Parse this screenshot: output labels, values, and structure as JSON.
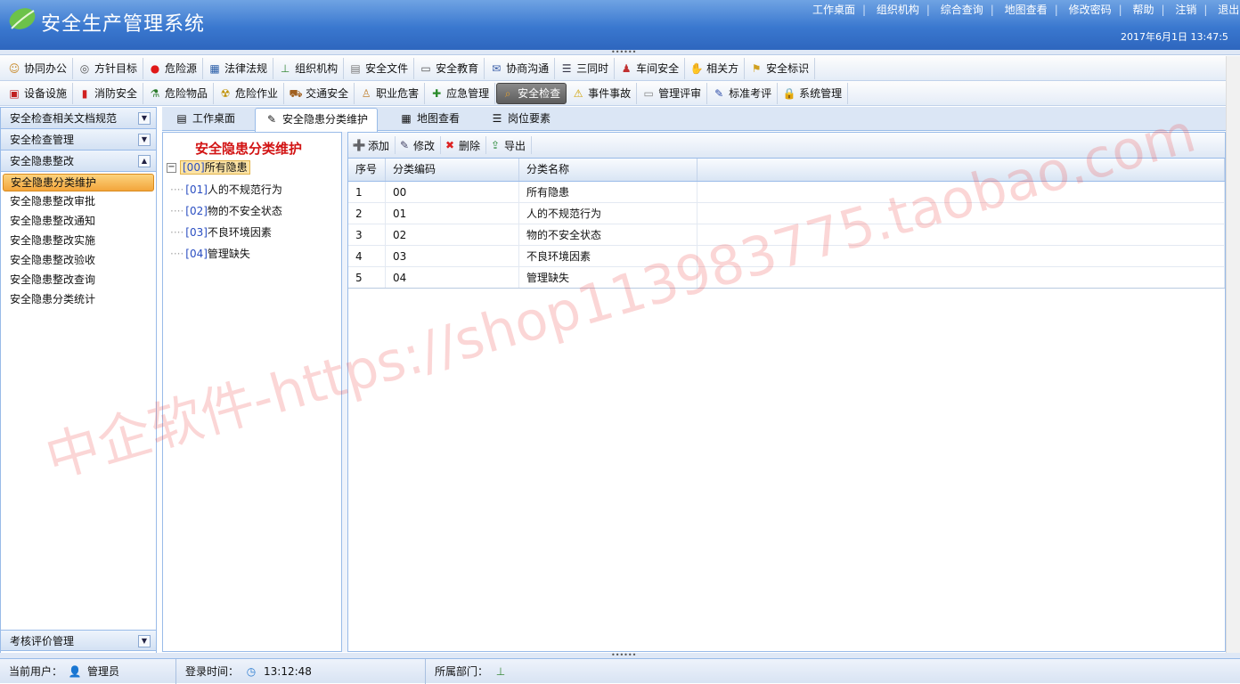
{
  "header": {
    "title": "安全生产管理系统",
    "links": [
      "工作桌面",
      "组织机构",
      "综合查询",
      "地图查看",
      "修改密码",
      "帮助",
      "注销",
      "退出"
    ],
    "datetime": "2017年6月1日 13:47:5"
  },
  "toolbar_row1": [
    {
      "label": "协同办公",
      "icon": "people-icon"
    },
    {
      "label": "方针目标",
      "icon": "target-icon"
    },
    {
      "label": "危险源",
      "icon": "red-dot-icon"
    },
    {
      "label": "法律法规",
      "icon": "table-icon"
    },
    {
      "label": "组织机构",
      "icon": "org-icon"
    },
    {
      "label": "安全文件",
      "icon": "notepad-icon"
    },
    {
      "label": "安全教育",
      "icon": "speech-icon"
    },
    {
      "label": "协商沟通",
      "icon": "mail-icon"
    },
    {
      "label": "三同时",
      "icon": "list-icon"
    },
    {
      "label": "车间安全",
      "icon": "person-lock-icon"
    },
    {
      "label": "相关方",
      "icon": "handshake-icon"
    },
    {
      "label": "安全标识",
      "icon": "flag-icon"
    }
  ],
  "toolbar_row2": [
    {
      "label": "设备设施",
      "icon": "device-icon"
    },
    {
      "label": "消防安全",
      "icon": "extinguisher-icon"
    },
    {
      "label": "危险物品",
      "icon": "flask-icon"
    },
    {
      "label": "危险作业",
      "icon": "warning-person-icon"
    },
    {
      "label": "交通安全",
      "icon": "truck-icon"
    },
    {
      "label": "职业危害",
      "icon": "worker-icon"
    },
    {
      "label": "应急管理",
      "icon": "emergency-icon"
    },
    {
      "label": "安全检查",
      "icon": "magnifier-icon",
      "active": true
    },
    {
      "label": "事件事故",
      "icon": "alert-icon"
    },
    {
      "label": "管理评审",
      "icon": "review-icon"
    },
    {
      "label": "标准考评",
      "icon": "edit-icon"
    },
    {
      "label": "系统管理",
      "icon": "lock-icon"
    }
  ],
  "sidebar": {
    "sections": [
      {
        "label": "安全检查相关文档规范",
        "toggle": "▼"
      },
      {
        "label": "安全检查管理",
        "toggle": "▼"
      },
      {
        "label": "安全隐患整改",
        "toggle": "▲"
      }
    ],
    "items": [
      "安全隐患分类维护",
      "安全隐患整改审批",
      "安全隐患整改通知",
      "安全隐患整改实施",
      "安全隐患整改验收",
      "安全隐患整改查询",
      "安全隐患分类统计"
    ],
    "selected_index": 0,
    "bottom_section": {
      "label": "考核评价管理",
      "toggle": "▼"
    }
  },
  "tabs": [
    "工作桌面",
    "安全隐患分类维护",
    "地图查看",
    "岗位要素"
  ],
  "active_tab": 1,
  "tree": {
    "title": "安全隐患分类维护",
    "root": {
      "code": "[00]",
      "label": "所有隐患"
    },
    "children": [
      {
        "code": "[01]",
        "label": "人的不规范行为"
      },
      {
        "code": "[02]",
        "label": "物的不安全状态"
      },
      {
        "code": "[03]",
        "label": "不良环境因素"
      },
      {
        "code": "[04]",
        "label": "管理缺失"
      }
    ]
  },
  "grid": {
    "actions": [
      "添加",
      "修改",
      "删除",
      "导出"
    ],
    "columns": [
      "序号",
      "分类编码",
      "分类名称"
    ],
    "rows": [
      [
        "1",
        "00",
        "所有隐患"
      ],
      [
        "2",
        "01",
        "人的不规范行为"
      ],
      [
        "3",
        "02",
        "物的不安全状态"
      ],
      [
        "4",
        "03",
        "不良环境因素"
      ],
      [
        "5",
        "04",
        "管理缺失"
      ]
    ]
  },
  "statusbar": {
    "user_label": "当前用户：",
    "user_value": "管理员",
    "login_label": "登录时间：",
    "login_value": "13:12:48",
    "dept_label": "所属部门：",
    "dept_value": ""
  },
  "watermark": "中企软件-https://shop113983775.taobao.com"
}
